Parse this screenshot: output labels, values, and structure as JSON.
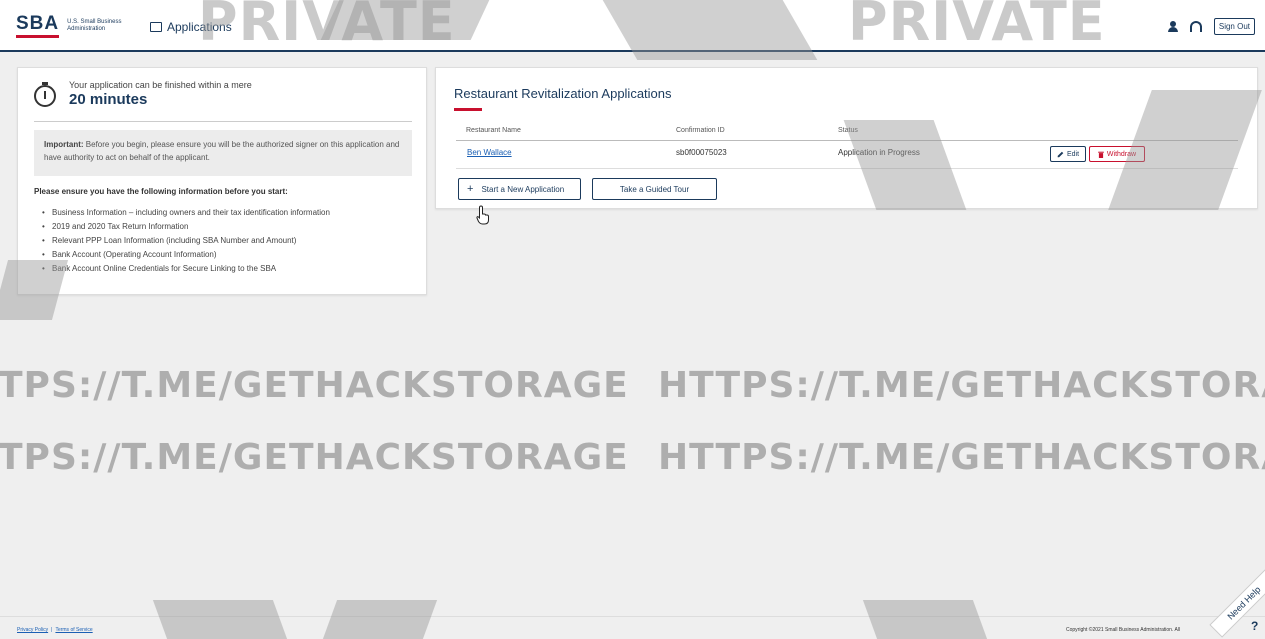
{
  "header": {
    "logo_mark": "SBA",
    "logo_text": "U.S. Small Business Administration",
    "nav_applications": "Applications",
    "sign_out": "Sign Out"
  },
  "left_card": {
    "finish_text": "Your application can be finished within a mere",
    "finish_minutes": "20 minutes",
    "important_label": "Important:",
    "important_text": "Before you begin, please ensure you will be the authorized signer on this application and have authority to act on behalf of the applicant.",
    "ensure_heading": "Please ensure you have the following information before you start:",
    "requirements": [
      "Business Information – including owners and their tax identification information",
      "2019 and 2020 Tax Return Information",
      "Relevant PPP Loan Information (including SBA Number and Amount)",
      "Bank Account (Operating Account Information)",
      "Bank Account Online Credentials for Secure Linking to the SBA"
    ]
  },
  "right_card": {
    "title": "Restaurant Revitalization Applications",
    "columns": [
      "Restaurant Name",
      "Confirmation ID",
      "Status"
    ],
    "rows": [
      {
        "restaurant_name": "Ben Wallace",
        "confirmation_id": "sb0f00075023",
        "status": "Application in Progress",
        "edit_label": "Edit",
        "withdraw_label": "Withdraw"
      }
    ],
    "start_new_label": "Start a New Application",
    "guided_tour_label": "Take a Guided Tour"
  },
  "footer": {
    "privacy": "Privacy Policy",
    "separator": "|",
    "terms": "Terms of Service",
    "copyright": "Copyright ©2021 Small Business Administration. All"
  },
  "help": {
    "need_help": "Need Help",
    "question_mark": "?"
  },
  "watermarks": {
    "private": "PRIVATE",
    "url_left": "TPS://T.ME/GETHACKSTORAGE",
    "url_right": "HTTPS://T.ME/GETHACKSTORA"
  },
  "colors": {
    "brand_navy": "#1b3a5c",
    "brand_red": "#c8102e",
    "link_blue": "#1a5fb4",
    "background": "#efefef"
  }
}
